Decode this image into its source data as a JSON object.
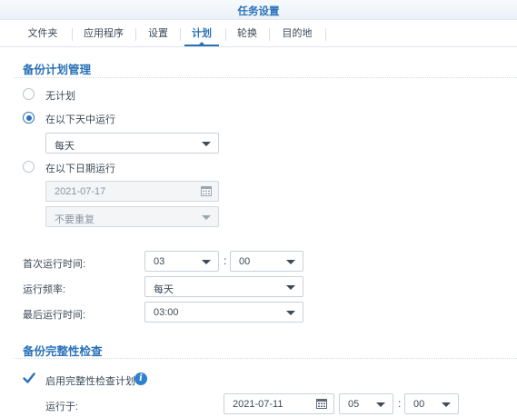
{
  "window": {
    "title": "任务设置"
  },
  "tabs": [
    {
      "label": "文件夹",
      "active": false
    },
    {
      "label": "应用程序",
      "active": false
    },
    {
      "label": "设置",
      "active": false
    },
    {
      "label": "计划",
      "active": true
    },
    {
      "label": "轮换",
      "active": false
    },
    {
      "label": "目的地",
      "active": false
    }
  ],
  "schedule": {
    "title": "备份计划管理",
    "options": {
      "none": {
        "label": "无计划",
        "selected": false
      },
      "days": {
        "label": "在以下天中运行",
        "selected": true,
        "value": "每天"
      },
      "date": {
        "label": "在以下日期运行",
        "selected": false,
        "date": "2021-07-17",
        "repeat": "不要重复"
      }
    },
    "first_run": {
      "label": "首次运行时间:",
      "hour": "03",
      "minute": "00",
      "separator": ":"
    },
    "frequency": {
      "label": "运行频率:",
      "value": "每天"
    },
    "last_run": {
      "label": "最后运行时间:",
      "value": "03:00"
    }
  },
  "integrity": {
    "title": "备份完整性检查",
    "enable": {
      "label": "启用完整性检查计划",
      "checked": true
    },
    "run_at": {
      "label": "运行于:",
      "date": "2021-07-11",
      "hour": "05",
      "minute": "00",
      "separator": ":"
    }
  },
  "colors": {
    "accent": "#2a72b8"
  }
}
